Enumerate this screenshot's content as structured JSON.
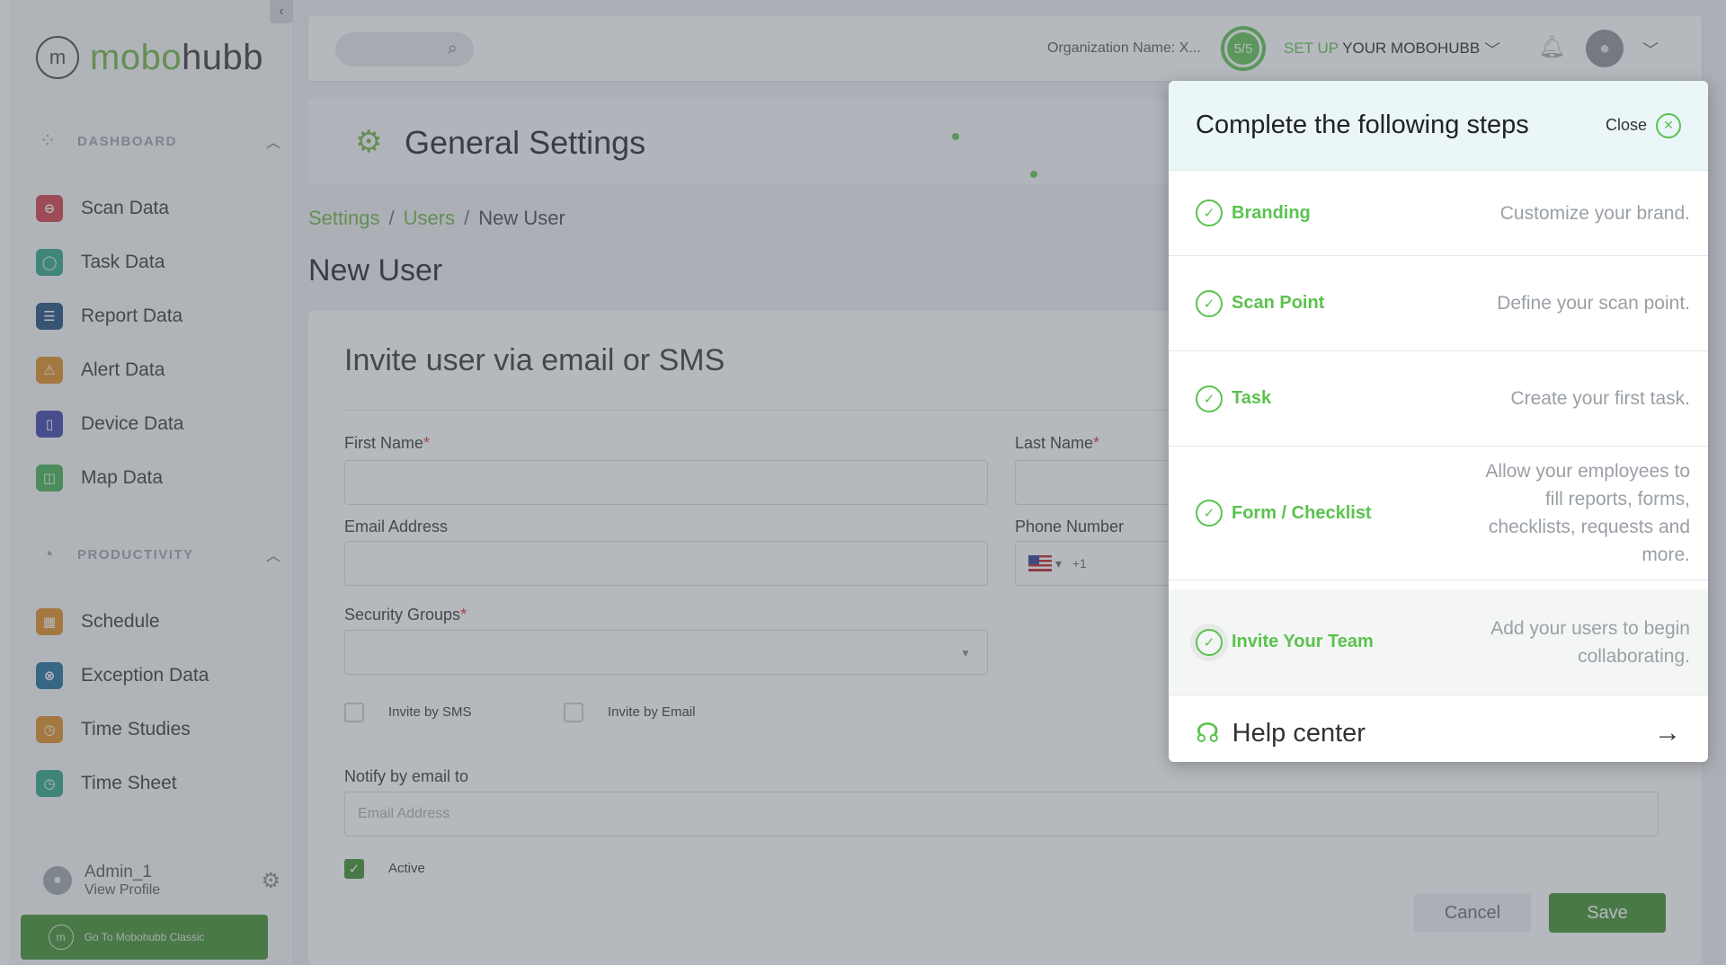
{
  "brand": {
    "logo_text_green": "mobo",
    "logo_text_dark": "hubb",
    "logo_mark": "m"
  },
  "sidebar": {
    "sections": [
      {
        "label": "DASHBOARD",
        "icon": "grid-icon"
      },
      {
        "label": "PRODUCTIVITY",
        "icon": "chart-icon"
      }
    ],
    "dashboard_items": [
      {
        "label": "Scan Data",
        "color": "#d43a44",
        "icon": "scan-icon"
      },
      {
        "label": "Task Data",
        "color": "#2aa384",
        "icon": "location-icon"
      },
      {
        "label": "Report Data",
        "color": "#1d4a7a",
        "icon": "report-icon"
      },
      {
        "label": "Alert Data",
        "color": "#e08a1e",
        "icon": "alert-icon"
      },
      {
        "label": "Device Data",
        "color": "#3a3ea8",
        "icon": "device-icon"
      },
      {
        "label": "Map Data",
        "color": "#3fae4f",
        "icon": "map-icon"
      }
    ],
    "productivity_items": [
      {
        "label": "Schedule",
        "color": "#e08a1e",
        "icon": "calendar-icon"
      },
      {
        "label": "Exception Data",
        "color": "#1d6a9a",
        "icon": "exception-icon"
      },
      {
        "label": "Time Studies",
        "color": "#e08a1e",
        "icon": "clock-icon"
      },
      {
        "label": "Time Sheet",
        "color": "#2aa384",
        "icon": "clock-icon"
      }
    ],
    "profile": {
      "name": "Admin_1",
      "link": "View Profile"
    },
    "classic_button": "Go To Mobohubb Classic"
  },
  "topbar": {
    "org_name": "Organization Name: X...",
    "progress": "5/5",
    "setup_prefix": "SET UP",
    "setup_suffix": "YOUR MOBOHUBB"
  },
  "page": {
    "title": "General Settings",
    "breadcrumb": {
      "a": "Settings",
      "b": "Users",
      "current": "New User"
    },
    "heading": "New User"
  },
  "form": {
    "title": "Invite user via email or SMS",
    "first_name": "First Name",
    "last_name": "Last Name",
    "email": "Email Address",
    "phone": "Phone Number",
    "phone_code": "+1",
    "security_groups": "Security Groups",
    "invite_sms": "Invite by SMS",
    "invite_email": "Invite by Email",
    "notify_label": "Notify by email to",
    "notify_placeholder": "Email Address",
    "active": "Active",
    "cancel": "Cancel",
    "save": "Save"
  },
  "steps_panel": {
    "title": "Complete the following steps",
    "close": "Close",
    "steps": [
      {
        "name": "Branding",
        "desc": "Customize your brand."
      },
      {
        "name": "Scan Point",
        "desc": "Define your scan point."
      },
      {
        "name": "Task",
        "desc": "Create your first task."
      },
      {
        "name": "Form / Checklist",
        "desc": "Allow your employees to fill reports, forms, checklists, requests and more."
      },
      {
        "name": "Invite Your Team",
        "desc": "Add your users to begin collaborating."
      }
    ],
    "help": "Help center"
  },
  "colors": {
    "accent": "#5bc24f",
    "primary_button": "#3d8c2a"
  }
}
